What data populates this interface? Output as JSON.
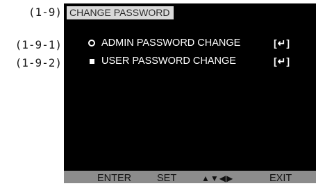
{
  "reference_labels": {
    "main": "(1-9)",
    "item1": "(1-9-1)",
    "item2": "(1-9-2)"
  },
  "screen": {
    "title": "CHANGE PASSWORD",
    "menu": [
      {
        "label": "ADMIN PASSWORD CHANGE",
        "key": "[↵]",
        "icon": "ring-icon"
      },
      {
        "label": "USER PASSWORD CHANGE",
        "key": "[↵]",
        "icon": "square-bullet-icon"
      }
    ],
    "bottom_bar": {
      "enter": "ENTER",
      "set": "SET",
      "arrows": "▲▼◀▶",
      "exit": "EXIT"
    }
  },
  "colors": {
    "screen_bg": "#000000",
    "title_bg": "#d9d9d9",
    "bottom_bar_bg": "#8c8c8c",
    "menu_text": "#ffffff"
  }
}
